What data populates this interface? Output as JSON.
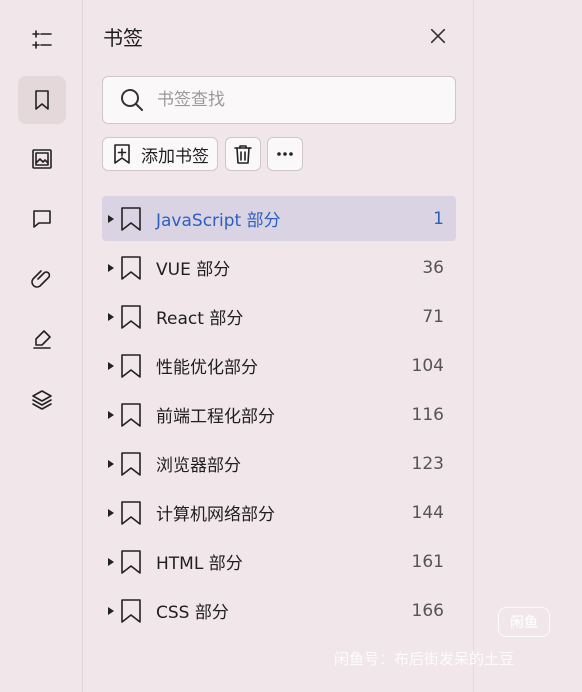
{
  "panel": {
    "title": "书签"
  },
  "search": {
    "placeholder": "书签查找"
  },
  "toolbar": {
    "add_label": "添加书签"
  },
  "bookmarks": [
    {
      "name": "JavaScript 部分",
      "page": "1",
      "selected": true
    },
    {
      "name": "VUE 部分",
      "page": "36"
    },
    {
      "name": "React 部分",
      "page": "71"
    },
    {
      "name": "性能优化部分",
      "page": "104"
    },
    {
      "name": "前端工程化部分",
      "page": "116"
    },
    {
      "name": "浏览器部分",
      "page": "123"
    },
    {
      "name": "计算机网络部分",
      "page": "144"
    },
    {
      "name": "HTML 部分",
      "page": "161"
    },
    {
      "name": "CSS 部分",
      "page": "166"
    }
  ],
  "watermark": {
    "logo": "闲鱼",
    "text": "闲鱼号：布后街发呆的土豆"
  },
  "colors": {
    "background": "#f1e6e9",
    "selected_row": "#d9d3e3",
    "selected_text": "#2d5fbf"
  }
}
